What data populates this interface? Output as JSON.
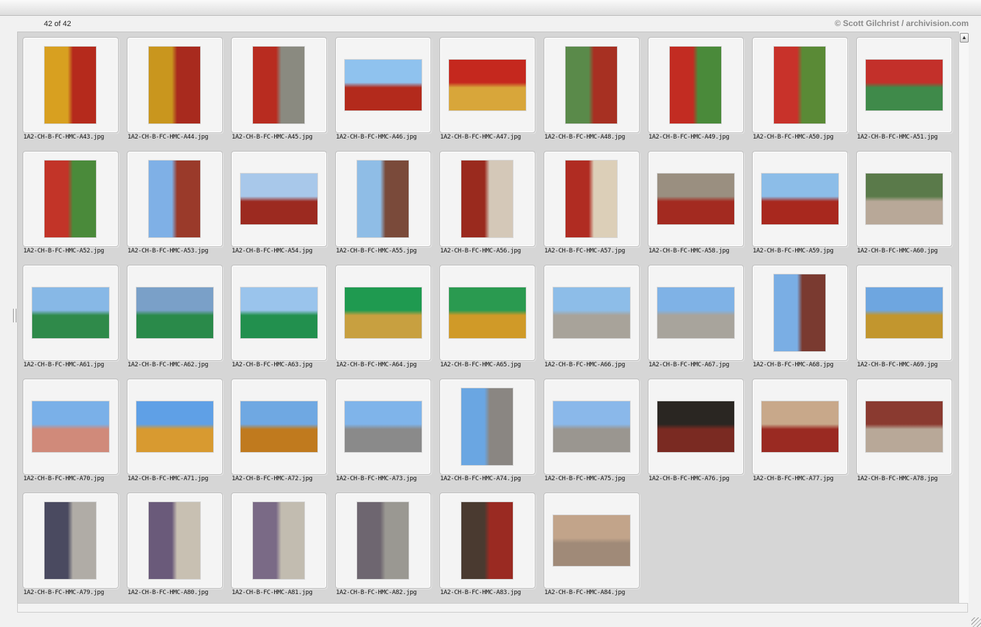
{
  "window": {
    "counter": "42 of 42",
    "credit": "© Scott Gilchrist / archivision.com"
  },
  "icons": {
    "scroll_up": "scroll-up-arrow-icon",
    "resize": "resize-grip-icon"
  },
  "thumbnails": [
    {
      "file": "1A2-CH-B-FC-HMC-A43.jpg",
      "orientation": "portrait",
      "colors": [
        "#d8a020",
        "#b52a1c"
      ]
    },
    {
      "file": "1A2-CH-B-FC-HMC-A44.jpg",
      "orientation": "portrait",
      "colors": [
        "#c9961e",
        "#a82a1e"
      ]
    },
    {
      "file": "1A2-CH-B-FC-HMC-A45.jpg",
      "orientation": "portrait",
      "colors": [
        "#b82c20",
        "#8a8a80"
      ]
    },
    {
      "file": "1A2-CH-B-FC-HMC-A46.jpg",
      "orientation": "landscape",
      "colors": [
        "#8fc2ee",
        "#b32a1c"
      ]
    },
    {
      "file": "1A2-CH-B-FC-HMC-A47.jpg",
      "orientation": "landscape",
      "colors": [
        "#c5281e",
        "#d8a63a"
      ]
    },
    {
      "file": "1A2-CH-B-FC-HMC-A48.jpg",
      "orientation": "portrait",
      "colors": [
        "#5a8a4a",
        "#a73022"
      ]
    },
    {
      "file": "1A2-CH-B-FC-HMC-A49.jpg",
      "orientation": "portrait",
      "colors": [
        "#c22c22",
        "#4a8a3a"
      ]
    },
    {
      "file": "1A2-CH-B-FC-HMC-A50.jpg",
      "orientation": "portrait",
      "colors": [
        "#c8322a",
        "#5a8a36"
      ]
    },
    {
      "file": "1A2-CH-B-FC-HMC-A51.jpg",
      "orientation": "landscape",
      "colors": [
        "#c3302a",
        "#3f8a4a"
      ]
    },
    {
      "file": "1A2-CH-B-FC-HMC-A52.jpg",
      "orientation": "portrait",
      "colors": [
        "#c23428",
        "#4a8a3a"
      ]
    },
    {
      "file": "1A2-CH-B-FC-HMC-A53.jpg",
      "orientation": "portrait",
      "colors": [
        "#7fb0e6",
        "#9a3a2a"
      ]
    },
    {
      "file": "1A2-CH-B-FC-HMC-A54.jpg",
      "orientation": "landscape",
      "colors": [
        "#a8c8ea",
        "#9c2a20"
      ]
    },
    {
      "file": "1A2-CH-B-FC-HMC-A55.jpg",
      "orientation": "portrait",
      "colors": [
        "#8fbde6",
        "#7a4a3a"
      ]
    },
    {
      "file": "1A2-CH-B-FC-HMC-A56.jpg",
      "orientation": "portrait",
      "colors": [
        "#9a2a1e",
        "#d4c8b8"
      ]
    },
    {
      "file": "1A2-CH-B-FC-HMC-A57.jpg",
      "orientation": "portrait",
      "colors": [
        "#b02c22",
        "#dccfb8"
      ]
    },
    {
      "file": "1A2-CH-B-FC-HMC-A58.jpg",
      "orientation": "landscape",
      "colors": [
        "#9a8f80",
        "#a32a20"
      ]
    },
    {
      "file": "1A2-CH-B-FC-HMC-A59.jpg",
      "orientation": "landscape",
      "colors": [
        "#8cbde8",
        "#a8281e"
      ]
    },
    {
      "file": "1A2-CH-B-FC-HMC-A60.jpg",
      "orientation": "landscape",
      "colors": [
        "#5a7a4a",
        "#b8a898"
      ]
    },
    {
      "file": "1A2-CH-B-FC-HMC-A61.jpg",
      "orientation": "landscape",
      "colors": [
        "#87b8e6",
        "#2f8a4a"
      ]
    },
    {
      "file": "1A2-CH-B-FC-HMC-A62.jpg",
      "orientation": "landscape",
      "colors": [
        "#7aa0c8",
        "#2a8a4a"
      ]
    },
    {
      "file": "1A2-CH-B-FC-HMC-A63.jpg",
      "orientation": "landscape",
      "colors": [
        "#9ac4ec",
        "#22904e"
      ]
    },
    {
      "file": "1A2-CH-B-FC-HMC-A64.jpg",
      "orientation": "landscape",
      "colors": [
        "#1f9a50",
        "#c8a040"
      ]
    },
    {
      "file": "1A2-CH-B-FC-HMC-A65.jpg",
      "orientation": "landscape",
      "colors": [
        "#2a9a50",
        "#d09a28"
      ]
    },
    {
      "file": "1A2-CH-B-FC-HMC-A66.jpg",
      "orientation": "landscape",
      "colors": [
        "#8dbde8",
        "#a8a39a"
      ]
    },
    {
      "file": "1A2-CH-B-FC-HMC-A67.jpg",
      "orientation": "landscape",
      "colors": [
        "#7fb2e6",
        "#a8a49c"
      ]
    },
    {
      "file": "1A2-CH-B-FC-HMC-A68.jpg",
      "orientation": "portrait",
      "colors": [
        "#7aaee4",
        "#7a3a30"
      ]
    },
    {
      "file": "1A2-CH-B-FC-HMC-A69.jpg",
      "orientation": "landscape",
      "colors": [
        "#6ea6e0",
        "#c2962e"
      ]
    },
    {
      "file": "1A2-CH-B-FC-HMC-A70.jpg",
      "orientation": "landscape",
      "colors": [
        "#7ab0e8",
        "#d08a7a"
      ]
    },
    {
      "file": "1A2-CH-B-FC-HMC-A71.jpg",
      "orientation": "landscape",
      "colors": [
        "#5fa0e6",
        "#d89a30"
      ]
    },
    {
      "file": "1A2-CH-B-FC-HMC-A72.jpg",
      "orientation": "landscape",
      "colors": [
        "#6fa8e2",
        "#c07a1e"
      ]
    },
    {
      "file": "1A2-CH-B-FC-HMC-A73.jpg",
      "orientation": "landscape",
      "colors": [
        "#7fb4ea",
        "#8a8a8a"
      ]
    },
    {
      "file": "1A2-CH-B-FC-HMC-A74.jpg",
      "orientation": "portrait",
      "colors": [
        "#6aa6e2",
        "#8a8682"
      ]
    },
    {
      "file": "1A2-CH-B-FC-HMC-A75.jpg",
      "orientation": "landscape",
      "colors": [
        "#8ab8ea",
        "#9a9690"
      ]
    },
    {
      "file": "1A2-CH-B-FC-HMC-A76.jpg",
      "orientation": "landscape",
      "colors": [
        "#2a2622",
        "#7a2a22"
      ]
    },
    {
      "file": "1A2-CH-B-FC-HMC-A77.jpg",
      "orientation": "landscape",
      "colors": [
        "#c8a88a",
        "#9a2a22"
      ]
    },
    {
      "file": "1A2-CH-B-FC-HMC-A78.jpg",
      "orientation": "landscape",
      "colors": [
        "#8a3a30",
        "#b8a898"
      ]
    },
    {
      "file": "1A2-CH-B-FC-HMC-A79.jpg",
      "orientation": "portrait",
      "colors": [
        "#4a4a60",
        "#b0aca6"
      ]
    },
    {
      "file": "1A2-CH-B-FC-HMC-A80.jpg",
      "orientation": "portrait",
      "colors": [
        "#6a5a7a",
        "#c8c0b2"
      ]
    },
    {
      "file": "1A2-CH-B-FC-HMC-A81.jpg",
      "orientation": "portrait",
      "colors": [
        "#7a6a86",
        "#c2bcb0"
      ]
    },
    {
      "file": "1A2-CH-B-FC-HMC-A82.jpg",
      "orientation": "portrait",
      "colors": [
        "#6e6670",
        "#9a9892"
      ]
    },
    {
      "file": "1A2-CH-B-FC-HMC-A83.jpg",
      "orientation": "portrait",
      "colors": [
        "#4a3a30",
        "#9a2a22"
      ]
    },
    {
      "file": "1A2-CH-B-FC-HMC-A84.jpg",
      "orientation": "landscape",
      "colors": [
        "#c2a48a",
        "#a08a78"
      ]
    }
  ]
}
